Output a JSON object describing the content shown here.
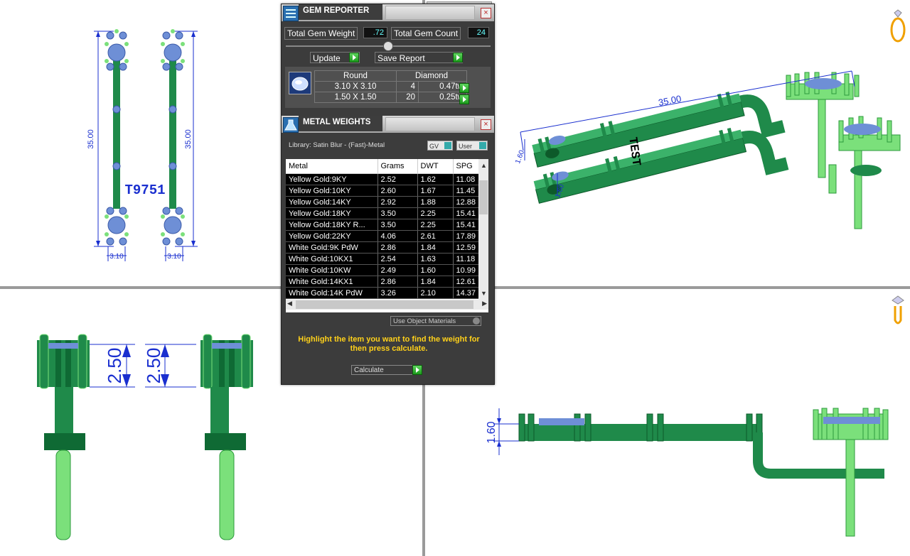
{
  "viewports": {
    "top_left": {
      "part_label": "T9751",
      "length_dims": [
        "35.00",
        "35.00"
      ],
      "width_dims": [
        "3.10",
        "3.10"
      ]
    },
    "top_right": {
      "length_dim": "35.00",
      "engraving": "TEST",
      "small_dims": [
        "1.60",
        "1.60"
      ]
    },
    "bottom_left": {
      "height_dims": [
        "2.50",
        "2.50"
      ]
    },
    "bottom_right": {
      "height_dim": "1.60"
    }
  },
  "gem_reporter": {
    "title": "GEM REPORTER",
    "close_label": "×",
    "total_gem_weight_label": "Total Gem Weight",
    "total_gem_weight_value": ".72",
    "total_gem_count_label": "Total Gem Count",
    "total_gem_count_value": "24",
    "update_label": "Update",
    "save_report_label": "Save Report",
    "gem_shape_header": "Round",
    "gem_type_header": "Diamond",
    "rows": [
      {
        "size": "3.10 X 3.10",
        "count": "4",
        "weight": "0.47tw"
      },
      {
        "size": "1.50 X 1.50",
        "count": "20",
        "weight": "0.25tw"
      }
    ]
  },
  "metal_weights": {
    "title": "METAL WEIGHTS",
    "close_label": "×",
    "library_label": "Library: Satin Blur - (Fast)-Metal",
    "gv_label": "GV",
    "user_label": "User",
    "columns": [
      "Metal",
      "Grams",
      "DWT",
      "SPG"
    ],
    "rows": [
      {
        "metal": "Yellow Gold:9KY",
        "grams": "2.52",
        "dwt": "1.62",
        "spg": "11.08"
      },
      {
        "metal": "Yellow Gold:10KY",
        "grams": "2.60",
        "dwt": "1.67",
        "spg": "11.45"
      },
      {
        "metal": "Yellow Gold:14KY",
        "grams": "2.92",
        "dwt": "1.88",
        "spg": "12.88"
      },
      {
        "metal": "Yellow Gold:18KY",
        "grams": "3.50",
        "dwt": "2.25",
        "spg": "15.41"
      },
      {
        "metal": "Yellow Gold:18KY R...",
        "grams": "3.50",
        "dwt": "2.25",
        "spg": "15.41"
      },
      {
        "metal": "Yellow Gold:22KY",
        "grams": "4.06",
        "dwt": "2.61",
        "spg": "17.89"
      },
      {
        "metal": "White Gold:9K PdW",
        "grams": "2.86",
        "dwt": "1.84",
        "spg": "12.59"
      },
      {
        "metal": "White Gold:10KX1",
        "grams": "2.54",
        "dwt": "1.63",
        "spg": "11.18"
      },
      {
        "metal": "White Gold:10KW",
        "grams": "2.49",
        "dwt": "1.60",
        "spg": "10.99"
      },
      {
        "metal": "White Gold:14KX1",
        "grams": "2.86",
        "dwt": "1.84",
        "spg": "12.61"
      },
      {
        "metal": "White Gold:14K PdW",
        "grams": "3.26",
        "dwt": "2.10",
        "spg": "14.37"
      }
    ],
    "use_object_materials_label": "Use Object Materials",
    "hint": "Highlight the item you want to find the weight for then press calculate.",
    "calculate_label": "Calculate"
  },
  "colors": {
    "metal_green": "#1f8a4a",
    "metal_light": "#7be07b",
    "gem_blue": "#6e8fd6",
    "dimension_blue": "#1a2fcf",
    "panel_bg": "#3c3c3c",
    "hint_yellow": "#ffd11a"
  }
}
